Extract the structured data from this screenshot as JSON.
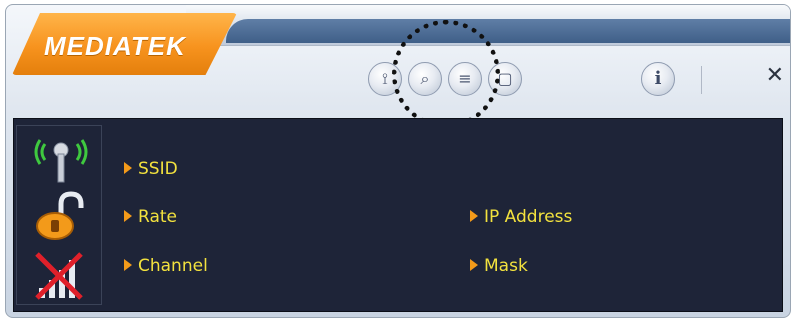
{
  "brand": {
    "logo_text": "MEDIATEK"
  },
  "toolbar": {
    "buttons": [
      {
        "name": "profile-icon",
        "glyph": "⟟"
      },
      {
        "name": "search-icon",
        "glyph": "⌕"
      },
      {
        "name": "list-icon",
        "glyph": "≡"
      },
      {
        "name": "page-icon",
        "glyph": "▢"
      }
    ],
    "info_glyph": "i",
    "close_glyph": "✕"
  },
  "status": {
    "signal_icon": "antenna-icon",
    "lock_icon": "unlock-icon",
    "bars_icon": "no-signal-icon"
  },
  "fields": {
    "ssid": "SSID",
    "rate": "Rate",
    "channel": "Channel",
    "ip_address": "IP Address",
    "mask": "Mask"
  },
  "colors": {
    "accent": "#f7931e",
    "panel_bg": "#1e2438",
    "label": "#f3e23e"
  }
}
